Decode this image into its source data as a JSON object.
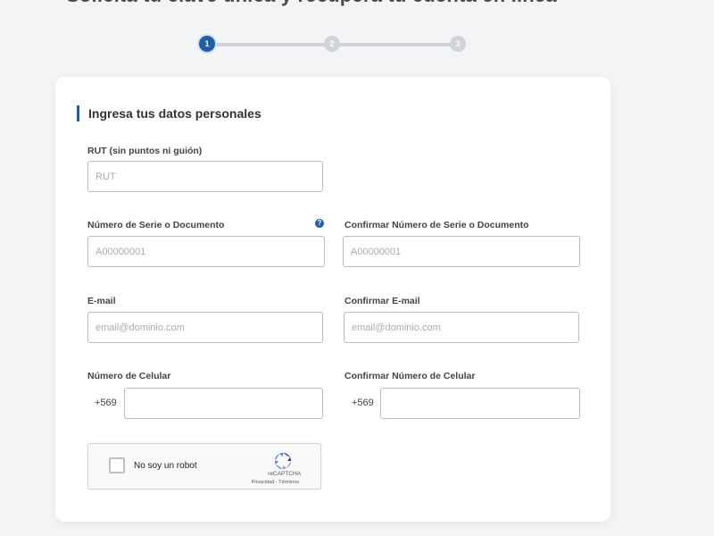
{
  "header": {
    "title_cutoff": "Solicita tu clave única y recupera tu cuenta en línea"
  },
  "stepper": {
    "steps": [
      "1",
      "2",
      "3"
    ],
    "active_step": 1
  },
  "form": {
    "section_title": "Ingresa tus datos personales",
    "rut": {
      "label": "RUT (sin puntos ni guión)",
      "placeholder": "RUT"
    },
    "serie": {
      "label": "Número de Serie o Documento",
      "placeholder": "A00000001",
      "help_icon": "?"
    },
    "serie_confirm": {
      "label": "Confirmar Número de Serie o Documento",
      "placeholder": "A00000001"
    },
    "email": {
      "label": "E-mail",
      "placeholder": "email@dominio.com"
    },
    "email_confirm": {
      "label": "Confirmar E-mail",
      "placeholder": "email@dominio.com"
    },
    "phone": {
      "label": "Número de Celular",
      "prefix": "+569",
      "value": ""
    },
    "phone_confirm": {
      "label": "Confirmar Número de Celular",
      "prefix": "+569",
      "value": ""
    },
    "recaptcha": {
      "label": "No soy un robot",
      "brand": "reCAPTCHA",
      "privacy": "Privacidad",
      "separator": "-",
      "terms": "Términos",
      "icon": "recaptcha-logo-icon"
    }
  },
  "colors": {
    "accent": "#1f5fa3",
    "background": "#f3f4f6",
    "card": "#ffffff",
    "input_border": "#b9bcc0"
  }
}
